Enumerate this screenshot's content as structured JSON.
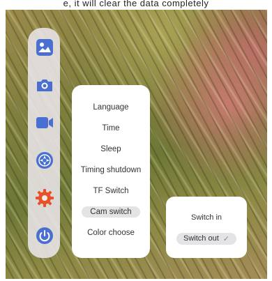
{
  "header": {
    "caption": "e, it will clear the data completely"
  },
  "sidebar": {
    "icons": [
      {
        "name": "gallery-icon",
        "color": "#4a6fd0"
      },
      {
        "name": "camera-icon",
        "color": "#4a6fd0"
      },
      {
        "name": "video-icon",
        "color": "#4a6fd0"
      },
      {
        "name": "navigation-icon",
        "color": "#4a6fd0"
      },
      {
        "name": "settings-icon",
        "color": "#e8502a"
      },
      {
        "name": "power-icon",
        "color": "#4a6fd0"
      }
    ]
  },
  "settings_menu": {
    "items": [
      {
        "label": "Language",
        "selected": false
      },
      {
        "label": "Time",
        "selected": false
      },
      {
        "label": "Sleep",
        "selected": false
      },
      {
        "label": "Timing shutdown",
        "selected": false
      },
      {
        "label": "TF Switch",
        "selected": false
      },
      {
        "label": "Cam switch",
        "selected": true
      },
      {
        "label": "Color choose",
        "selected": false
      }
    ]
  },
  "cam_switch_menu": {
    "items": [
      {
        "label": "Switch in",
        "selected": false
      },
      {
        "label": "Switch out",
        "selected": true,
        "check": "✓"
      }
    ]
  },
  "colors": {
    "accent_blue": "#4a6fd0",
    "accent_orange": "#e8502a",
    "selected_bg": "#e4e4e6"
  }
}
